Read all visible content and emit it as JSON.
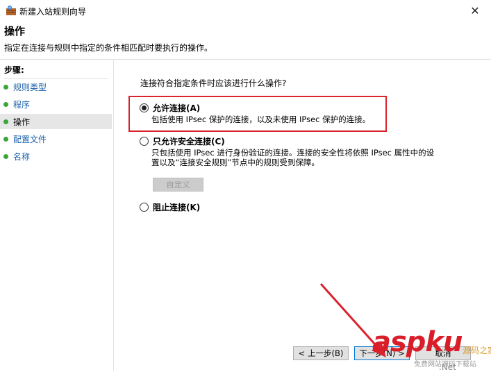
{
  "window": {
    "title": "新建入站规则向导",
    "close_symbol": "✕"
  },
  "header": {
    "title": "操作",
    "subtitle": "指定在连接与规则中指定的条件相匹配时要执行的操作。"
  },
  "sidebar": {
    "steps_label": "步骤:",
    "items": [
      {
        "label": "规则类型"
      },
      {
        "label": "程序"
      },
      {
        "label": "操作"
      },
      {
        "label": "配置文件"
      },
      {
        "label": "名称"
      }
    ]
  },
  "main": {
    "question": "连接符合指定条件时应该进行什么操作?",
    "options": [
      {
        "label": "允许连接(A)",
        "desc": "包括使用 IPsec 保护的连接，以及未使用 IPsec 保护的连接。",
        "checked": true
      },
      {
        "label": "只允许安全连接(C)",
        "desc_line1": "只包括使用 IPsec 进行身份验证的连接。连接的安全性将依照 IPsec 属性中的设",
        "desc_line2": "置以及“连接安全规则”节点中的规则受到保障。",
        "checked": false
      },
      {
        "label": "阻止连接(K)",
        "checked": false
      }
    ],
    "customize_label": "自定义"
  },
  "footer": {
    "back_label": "< 上一步(B)",
    "next_label": "下一步(N) >",
    "cancel_label": "取消"
  },
  "watermark": {
    "text": "aspku",
    "cn": "源码之家",
    "sub": "免费网站源码下载站",
    "net": ".Net"
  },
  "colors": {
    "highlight": "#d9232d",
    "step_dot": "#3aa63a",
    "step_link": "#1a5fa8"
  }
}
